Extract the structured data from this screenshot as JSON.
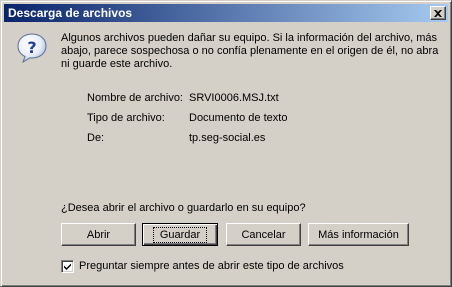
{
  "window": {
    "title": "Descarga de archivos"
  },
  "message": "Algunos archivos pueden dañar su equipo. Si la información del archivo, más abajo, parece sospechosa o no confía plenamente en el origen de él, no abra ni guarde este archivo.",
  "file_info": {
    "name_label": "Nombre de archivo:",
    "name_value": "SRVI0006.MSJ.txt",
    "type_label": "Tipo de archivo:",
    "type_value": "Documento de texto",
    "from_label": "De:",
    "from_value": "tp.seg-social.es"
  },
  "question": "¿Desea abrir el archivo o guardarlo en su equipo?",
  "buttons": {
    "open": "Abrir",
    "save": "Guardar",
    "cancel": "Cancelar",
    "more_info": "Más información"
  },
  "checkbox": {
    "label": "Preguntar siempre antes de abrir este tipo de archivos",
    "checked": true
  },
  "icons": {
    "dialog_icon": "question-icon",
    "close": "close-icon"
  },
  "colors": {
    "titlebar_start": "#0a246a",
    "titlebar_end": "#a6caf0",
    "face": "#d4d0c8"
  }
}
